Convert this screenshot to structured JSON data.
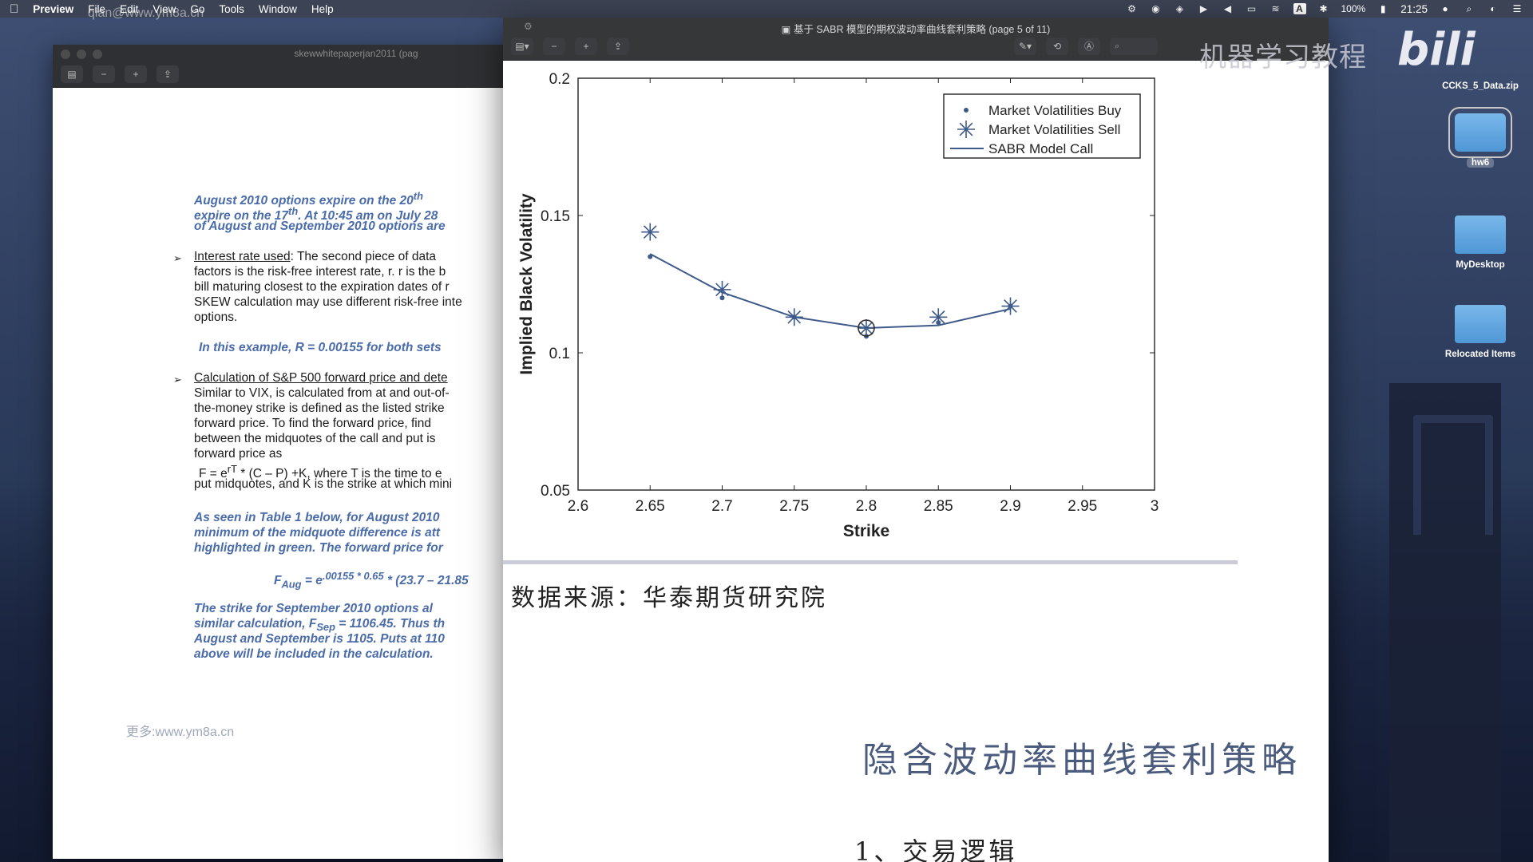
{
  "menubar": {
    "app_name": "Preview",
    "items": [
      "File",
      "Edit",
      "View",
      "Go",
      "Tools",
      "Window",
      "Help"
    ],
    "battery": "100%",
    "clock": "21:25",
    "overlay_text": "qian@www.ym8a.cn"
  },
  "back_window": {
    "title": "skewwhitepaperjan2011 (pag",
    "para1": [
      "August 2010 options expire on the 20",
      "expire on the 17",
      ". At 10:45 am on July 28",
      "of August and September 2010 options are"
    ],
    "sup_th": "th",
    "bullet1_title": "Interest rate used",
    "bullet1_lines": [
      ": The second piece of data",
      "factors is the risk-free interest rate, r. r is the b",
      "bill maturing closest to the expiration dates of r",
      "SKEW calculation may use different risk-free inte",
      "options."
    ],
    "example_line": "In this example, R = 0.00155 for both sets",
    "bullet2_title": "Calculation of S&P 500 forward price and dete",
    "bullet2_lines": [
      "Similar to VIX, is calculated from at and out-of-",
      "the-money strike is defined as the listed strike",
      "forward price.  To find the forward price, find",
      "between the midquotes of the call and put is",
      "forward price as"
    ],
    "formula_line_a": "F = e",
    "formula_sup": "rT",
    "formula_line_b": " * (C – P) +K, where T is the time to e",
    "formula_line_c": "put midquotes, and K is the strike at which mini",
    "para3": [
      "As seen in Table 1 below, for August 2010",
      "minimum of the midquote difference is att",
      "highlighted in green. The forward price for"
    ],
    "faug_a": "F",
    "faug_sub": "Aug",
    "faug_b": " = e",
    "faug_sup": ".00155 * 0.65",
    "faug_c": " * (23.7 – 21.85",
    "para4a": "The strike for September 2010 options al",
    "para4b_a": "similar calculation, F",
    "para4b_sub": "Sep",
    "para4b_b": " = 1106.45. Thus th",
    "para4c": "August and September is 1105. Puts at 110",
    "para4d": "above will be included in the calculation.",
    "watermark_link": "更多:www.ym8a.cn"
  },
  "front_window": {
    "title": "基于 SABR 模型的期权波动率曲线套利策略 (page 5 of 11)",
    "channel_tag": "机器学习教程",
    "source_line": "数据来源：华泰期货研究院",
    "section_title": "隐含波动率曲线套利策略",
    "subsection": "1、交易逻辑"
  },
  "chart_data": {
    "type": "line",
    "xlabel": "Strike",
    "ylabel": "Implied Black Volatility",
    "xlim": [
      2.6,
      3.0
    ],
    "ylim": [
      0.05,
      0.2
    ],
    "xticks": [
      "2.6",
      "2.65",
      "2.7",
      "2.75",
      "2.8",
      "2.85",
      "2.9",
      "2.95",
      "3"
    ],
    "yticks": [
      "0.05",
      "0.1",
      "0.15",
      "0.2"
    ],
    "legend_position": "top-right",
    "series": [
      {
        "name": "Market Volatilities Buy",
        "marker": "dot",
        "x": [
          2.65,
          2.7,
          2.75,
          2.8,
          2.85,
          2.9
        ],
        "y": [
          0.135,
          0.12,
          0.113,
          0.106,
          0.111,
          0.117
        ]
      },
      {
        "name": "Market Volatilities Sell",
        "marker": "star",
        "x": [
          2.65,
          2.7,
          2.75,
          2.8,
          2.85,
          2.9
        ],
        "y": [
          0.144,
          0.123,
          0.113,
          0.109,
          0.113,
          0.117
        ]
      },
      {
        "name": "SABR Model Call",
        "marker": "line",
        "x": [
          2.65,
          2.7,
          2.75,
          2.8,
          2.85,
          2.9
        ],
        "y": [
          0.136,
          0.122,
          0.113,
          0.109,
          0.11,
          0.116
        ]
      }
    ]
  },
  "desktop": {
    "zip_label": "CCKS_5_Data.zip",
    "icons": [
      {
        "label": "hw6"
      },
      {
        "label": "MyDesktop"
      },
      {
        "label": "Relocated Items"
      }
    ],
    "brand": "bili"
  },
  "colors": {
    "series": "#3d5a8a",
    "blue_text": "#4a6caa"
  }
}
